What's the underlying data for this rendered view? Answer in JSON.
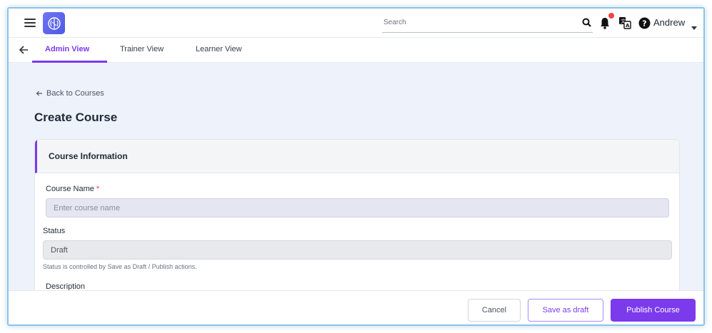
{
  "header": {
    "search_placeholder": "Search",
    "user_name": "Andrew",
    "brand_color": "#5b63ee",
    "notification_dot_color": "#ef4444"
  },
  "tabs": [
    {
      "label": "Admin View",
      "active": true
    },
    {
      "label": "Trainer View",
      "active": false
    },
    {
      "label": "Learner View",
      "active": false
    }
  ],
  "page": {
    "back_link": "Back to Courses",
    "title": "Create Course"
  },
  "card": {
    "title": "Course Information",
    "course_name_label": "Course Name",
    "required_mark": "*",
    "course_name_placeholder": "Enter course name",
    "status_label": "Status",
    "status_value": "Draft",
    "status_helper": "Status is controlled by Save as Draft / Publish actions.",
    "description_label": "Description"
  },
  "footer": {
    "cancel": "Cancel",
    "save_draft": "Save as draft",
    "publish": "Publish Course"
  },
  "colors": {
    "accent": "#7c3aed",
    "background": "#eef2fb"
  }
}
